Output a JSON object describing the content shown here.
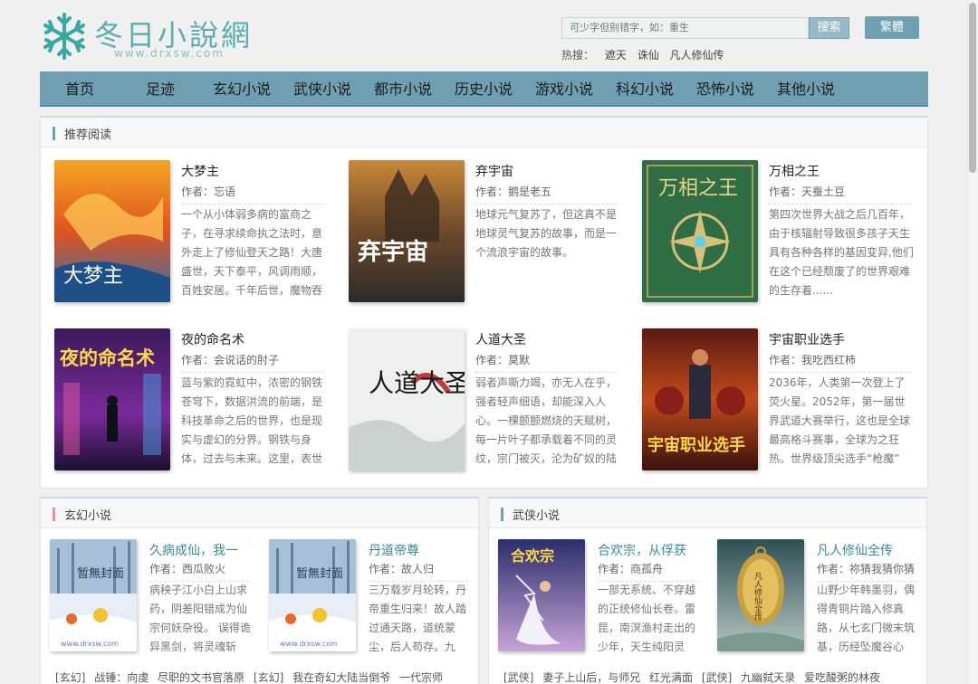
{
  "site": {
    "title": "冬日小說網",
    "url": "www.drxsw.com"
  },
  "search": {
    "placeholder": "可少字但别错字，如：重生",
    "button": "搜索",
    "fanti": "繁體"
  },
  "hot": {
    "label": "热搜：",
    "links": [
      "遮天",
      "诛仙",
      "凡人修仙传"
    ]
  },
  "nav": [
    "首页",
    "足迹",
    "玄幻小说",
    "武侠小说",
    "都市小说",
    "历史小说",
    "游戏小说",
    "科幻小说",
    "恐怖小说",
    "其他小说"
  ],
  "recommend": {
    "title": "推荐阅读",
    "books": [
      {
        "title": "大梦主",
        "author": "作者：忘语",
        "desc": "一个从小体弱多病的富商之子，在寻求续命执之法时，意外走上了修仙登天之路！大唐盛世，天下泰平，风调雨顺，百姓安居。千年后世，魔物吞",
        "cover_text": "大梦主"
      },
      {
        "title": "弃宇宙",
        "author": "作者：鹅是老五",
        "desc": "地球元气复苏了，但这真不是地球灵气复苏的故事，而是一个流浪宇宙的故事。",
        "cover_text": "弃宇宙"
      },
      {
        "title": "万相之王",
        "author": "作者：天蚕土豆",
        "desc": "第四次世界大战之后几百年，由于核辐射导致很多孩子天生具有各种各样的基因变异,他们在这个已经颓废了的世界艰难的生存着......",
        "cover_text": "万相之王"
      },
      {
        "title": "夜的命名术",
        "author": "作者：会说话的肘子",
        "desc": "蓝与紫的霓虹中，浓密的钢铁苍穹下，数据洪流的前端，是科技革命之后的世界，也是现实与虚幻的分界。钢铁与身体，过去与未来。这里，表世",
        "cover_text": "夜的命名术"
      },
      {
        "title": "人道大圣",
        "author": "作者：莫默",
        "desc": "弱者声嘶力竭，亦无人在乎，强者轻声细语，却能深入人心。一棵颤颤燃烧的天赋树，每一片叶子都承载着不同的灵纹，宗门被灭，沦为矿奴的陆",
        "cover_text": "人道大圣"
      },
      {
        "title": "宇宙职业选手",
        "author": "作者：我吃西红柿",
        "desc": "2036年，人类第一次登上了荧火星。2052年，第一届世界武道大赛举行，这也是全球最高格斗赛事，全球为之狂热。世界级顶尖选手“枪魔”",
        "cover_text": "宇宙职业选手"
      }
    ]
  },
  "xuanhuan": {
    "title": "玄幻小说",
    "books": [
      {
        "title": "久病成仙，我一",
        "author": "作者：西瓜败火",
        "desc": "病秧子江小白上山求药，阴差阳错成为仙宗何妖杂役。 误得诡异黑剑，将灵魂斩",
        "cover_text": "暂無封面"
      },
      {
        "title": "丹道帝尊",
        "author": "作者：故人归",
        "desc": "三万载岁月轮转，丹帝重生归来！故人踏过通天路，道统蒙尘，后人苟存。九",
        "cover_text": "暂無封面"
      }
    ],
    "list": [
      "[玄幻]",
      "战锤：向虔",
      "尽职的文书官落原",
      "[玄幻]",
      "我在奇幻大陆当倒爷",
      "一代宗师"
    ]
  },
  "wuxia": {
    "title": "武侠小说",
    "books": [
      {
        "title": "合欢宗，从俘获",
        "author": "作者：商孤舟",
        "desc": "一部无系统、不穿越的正统修仙长卷。雷昆，南溟渔村走出的少年，天生纯阳灵",
        "cover_text": "合欢宗"
      },
      {
        "title": "凡人修仙全传",
        "author": "作者：祢猜我猜你猜",
        "desc": "山野少年韩墨羽，偶得青铜片踏入修真路，从七玄门微末筑基，历经坠魔谷心",
        "cover_text": "凡人修仙全传"
      }
    ],
    "list": [
      "[武侠]",
      "妻子上山后，与师兄",
      "红光满面",
      "[武侠]",
      "九幽弑天录",
      "爱吃酸粥的林夜"
    ]
  },
  "watermark": "www.drxsw.com"
}
